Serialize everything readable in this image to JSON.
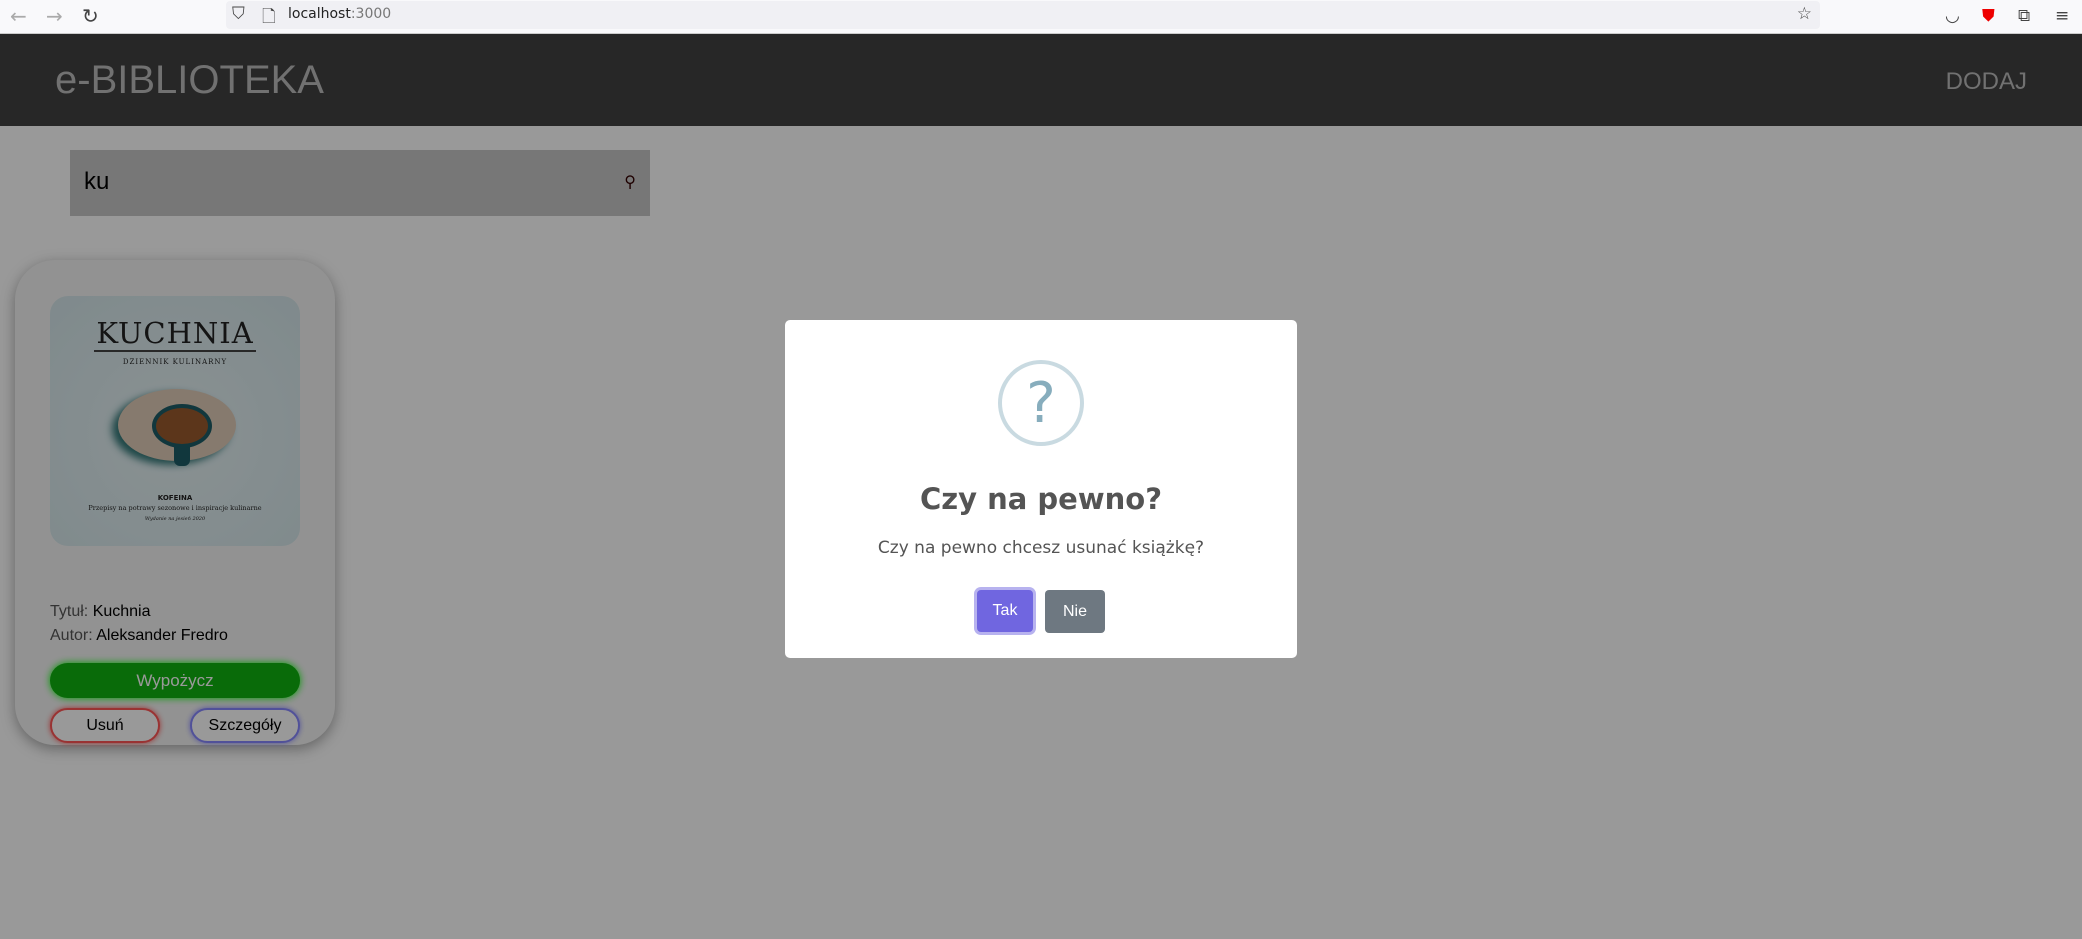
{
  "browser": {
    "url_host": "localhost",
    "url_port": ":3000"
  },
  "header": {
    "logo": "e-BIBLIOTEKA",
    "add_link": "DODAJ"
  },
  "search": {
    "value": "ku"
  },
  "books": [
    {
      "cover": {
        "title": "KUCHNIA",
        "subtitle": "DZIENNIK KULINARNY",
        "tag": "KOFEINA",
        "tagline": "Przepisy na potrawy sezonowe i inspiracje kulinarne",
        "edition": "Wydanie na jesień 2020"
      },
      "title_label": "Tytuł:",
      "title": "Kuchnia",
      "author_label": "Autor:",
      "author": "Aleksander Fredro",
      "borrow": "Wypożycz",
      "delete": "Usuń",
      "details": "Szczegóły"
    }
  ],
  "modal": {
    "icon": "question-icon",
    "icon_glyph": "?",
    "title": "Czy na pewno?",
    "text": "Czy na pewno chcesz usunać książkę?",
    "confirm": "Tak",
    "cancel": "Nie"
  },
  "colors": {
    "confirm": "#7066e0",
    "cancel": "#6e7881",
    "borrow": "#0fb30f",
    "delete": "#ff5555",
    "details": "#8888ff"
  }
}
